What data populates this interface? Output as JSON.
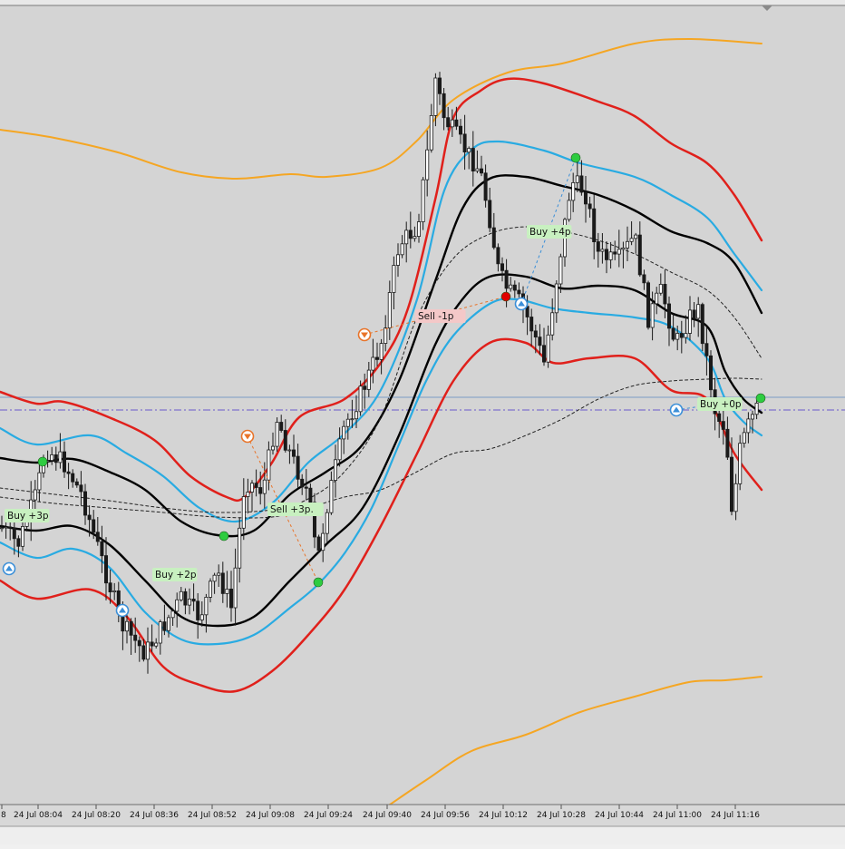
{
  "chart_data": {
    "type": "candlestick",
    "title": "",
    "xlabel": "",
    "ylabel": "",
    "grid": false,
    "x_tick_labels": [
      "8",
      "24 Jul 08:04",
      "24 Jul 08:20",
      "24 Jul 08:36",
      "24 Jul 08:52",
      "24 Jul 09:08",
      "24 Jul 09:24",
      "24 Jul 09:40",
      "24 Jul 09:56",
      "24 Jul 10:12",
      "24 Jul 10:28",
      "24 Jul 10:44",
      "24 Jul 11:00",
      "24 Jul 11:16"
    ],
    "candle_color": "#1a1a1a",
    "series": [
      {
        "role": "outer-band-upper",
        "color": "#f5a623",
        "values": [
          0.82,
          0.81,
          0.8,
          0.79,
          0.78,
          0.77,
          0.77,
          0.78,
          0.8,
          0.84,
          0.89,
          0.92,
          0.94,
          0.955,
          0.96,
          0.96,
          0.955,
          0.955
        ]
      },
      {
        "role": "outer-band-lower",
        "color": "#f5a623",
        "values": [
          -0.3,
          -0.29,
          -0.28,
          -0.27,
          -0.26,
          -0.24,
          -0.22,
          -0.17,
          -0.1,
          -0.05,
          -0.02,
          0.01,
          0.04,
          0.06,
          0.08,
          0.1,
          0.11,
          0.12
        ]
      },
      {
        "role": "red-band-upper",
        "color": "#e0201b",
        "values": [
          0.46,
          0.43,
          0.41,
          0.4,
          0.41,
          0.4,
          0.37,
          0.35,
          0.36,
          0.4,
          0.47,
          0.58,
          0.72,
          0.85,
          0.89,
          0.89,
          0.87,
          0.85,
          0.84,
          0.81,
          0.77,
          0.69,
          0.62
        ]
      },
      {
        "role": "red-band-lower",
        "color": "#e0201b",
        "values": [
          0.24,
          0.21,
          0.2,
          0.18,
          0.16,
          0.13,
          0.12,
          0.14,
          0.2,
          0.3,
          0.38,
          0.45,
          0.48,
          0.49,
          0.48,
          0.47,
          0.46,
          0.44,
          0.42,
          0.38
        ]
      },
      {
        "role": "blue-band-upper",
        "color": "#29abe2",
        "values": [
          0.43,
          0.41,
          0.39,
          0.37,
          0.36,
          0.35,
          0.33,
          0.32,
          0.35,
          0.38,
          0.44,
          0.52,
          0.64,
          0.76,
          0.8,
          0.81,
          0.8,
          0.77,
          0.73,
          0.69,
          0.65,
          0.61,
          0.57,
          0.54
        ]
      },
      {
        "role": "blue-band-lower",
        "color": "#29abe2",
        "values": [
          0.28,
          0.26,
          0.24,
          0.23,
          0.22,
          0.2,
          0.19,
          0.21,
          0.25,
          0.31,
          0.4,
          0.5,
          0.58,
          0.63,
          0.62,
          0.61,
          0.59,
          0.57,
          0.54,
          0.48,
          0.42,
          0.4,
          0.38
        ]
      },
      {
        "role": "black-midline-upper",
        "color": "#000000",
        "values": [
          0.4,
          0.38,
          0.36,
          0.34,
          0.33,
          0.32,
          0.3,
          0.28,
          0.31,
          0.36,
          0.42,
          0.5,
          0.6,
          0.68,
          0.74,
          0.76,
          0.75,
          0.72,
          0.7,
          0.67,
          0.63,
          0.6,
          0.57
        ]
      },
      {
        "role": "black-midline-lower",
        "color": "#000000",
        "values": [
          0.34,
          0.32,
          0.3,
          0.28,
          0.27,
          0.26,
          0.25,
          0.26,
          0.3,
          0.37,
          0.45,
          0.54,
          0.6,
          0.64,
          0.64,
          0.63,
          0.62,
          0.6,
          0.57,
          0.54,
          0.5
        ]
      },
      {
        "role": "dashed-band-upper",
        "color": "#222222",
        "values": [
          0.38,
          0.37,
          0.35,
          0.33,
          0.32,
          0.32,
          0.31,
          0.33,
          0.37,
          0.43,
          0.51,
          0.6,
          0.67,
          0.71,
          0.72,
          0.71,
          0.69,
          0.66,
          0.63,
          0.6
        ]
      },
      {
        "role": "dashed-band-lower",
        "color": "#222222",
        "values": [
          0.36,
          0.34,
          0.32,
          0.31,
          0.3,
          0.3,
          0.31,
          0.35,
          0.41,
          0.47,
          0.52,
          0.55,
          0.56,
          0.57,
          0.57,
          0.55,
          0.54,
          0.51
        ]
      }
    ],
    "signals": [
      {
        "text": "Buy +3p",
        "kind": "buy"
      },
      {
        "text": "Buy +2p",
        "kind": "buy"
      },
      {
        "text": "Sell +3p.",
        "kind": "buy"
      },
      {
        "text": "Sell -1p",
        "kind": "sell"
      },
      {
        "text": "Buy +4p",
        "kind": "buy"
      },
      {
        "text": "Buy +0p",
        "kind": "buy"
      }
    ],
    "colors": {
      "background": "#d4d4d4",
      "candle": "#1a1a1a",
      "buy_dot": "#2ecc40",
      "sell_dot": "#e00000",
      "arrow_blue": "#3b8fd8",
      "arrow_orange": "#e8742a",
      "hline": "#7a9cc6",
      "dashdot": "#6a5acd",
      "label_buy_bg": "#c8f0c0",
      "label_sell_bg": "#f4c8c8"
    }
  }
}
